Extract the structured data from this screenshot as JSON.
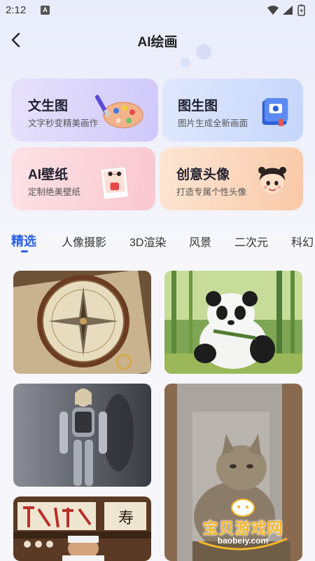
{
  "status_bar": {
    "time": "2:12",
    "notification_icon": "A"
  },
  "header": {
    "title": "AI绘画"
  },
  "feature_cards": [
    {
      "title": "文生图",
      "subtitle": "文字秒变精美画作",
      "icon": "palette-icon"
    },
    {
      "title": "图生图",
      "subtitle": "图片生成全新画面",
      "icon": "photo-book-icon"
    },
    {
      "title": "AI壁纸",
      "subtitle": "定制绝美壁纸",
      "icon": "wallpaper-girl-icon"
    },
    {
      "title": "创意头像",
      "subtitle": "打造专属个性头像",
      "icon": "avatar-girl-icon"
    }
  ],
  "tabs": [
    {
      "label": "精选",
      "active": true
    },
    {
      "label": "人像摄影",
      "active": false
    },
    {
      "label": "3D渲染",
      "active": false
    },
    {
      "label": "风景",
      "active": false
    },
    {
      "label": "二次元",
      "active": false
    },
    {
      "label": "科幻",
      "active": false
    }
  ],
  "gallery": [
    {
      "name": "compass-image",
      "subject": "compass"
    },
    {
      "name": "panda-image",
      "subject": "panda"
    },
    {
      "name": "robot-woman-image",
      "subject": "robot woman"
    },
    {
      "name": "cat-statue-image",
      "subject": "cat statue"
    },
    {
      "name": "sushi-chef-image",
      "subject": "sushi chef"
    }
  ],
  "watermark": {
    "text": "宝贝游戏网",
    "url": "baobeiy.com"
  },
  "sushi_sign_text": "寿",
  "colors": {
    "accent": "#2a60e8",
    "watermark": "#f4b72c"
  }
}
